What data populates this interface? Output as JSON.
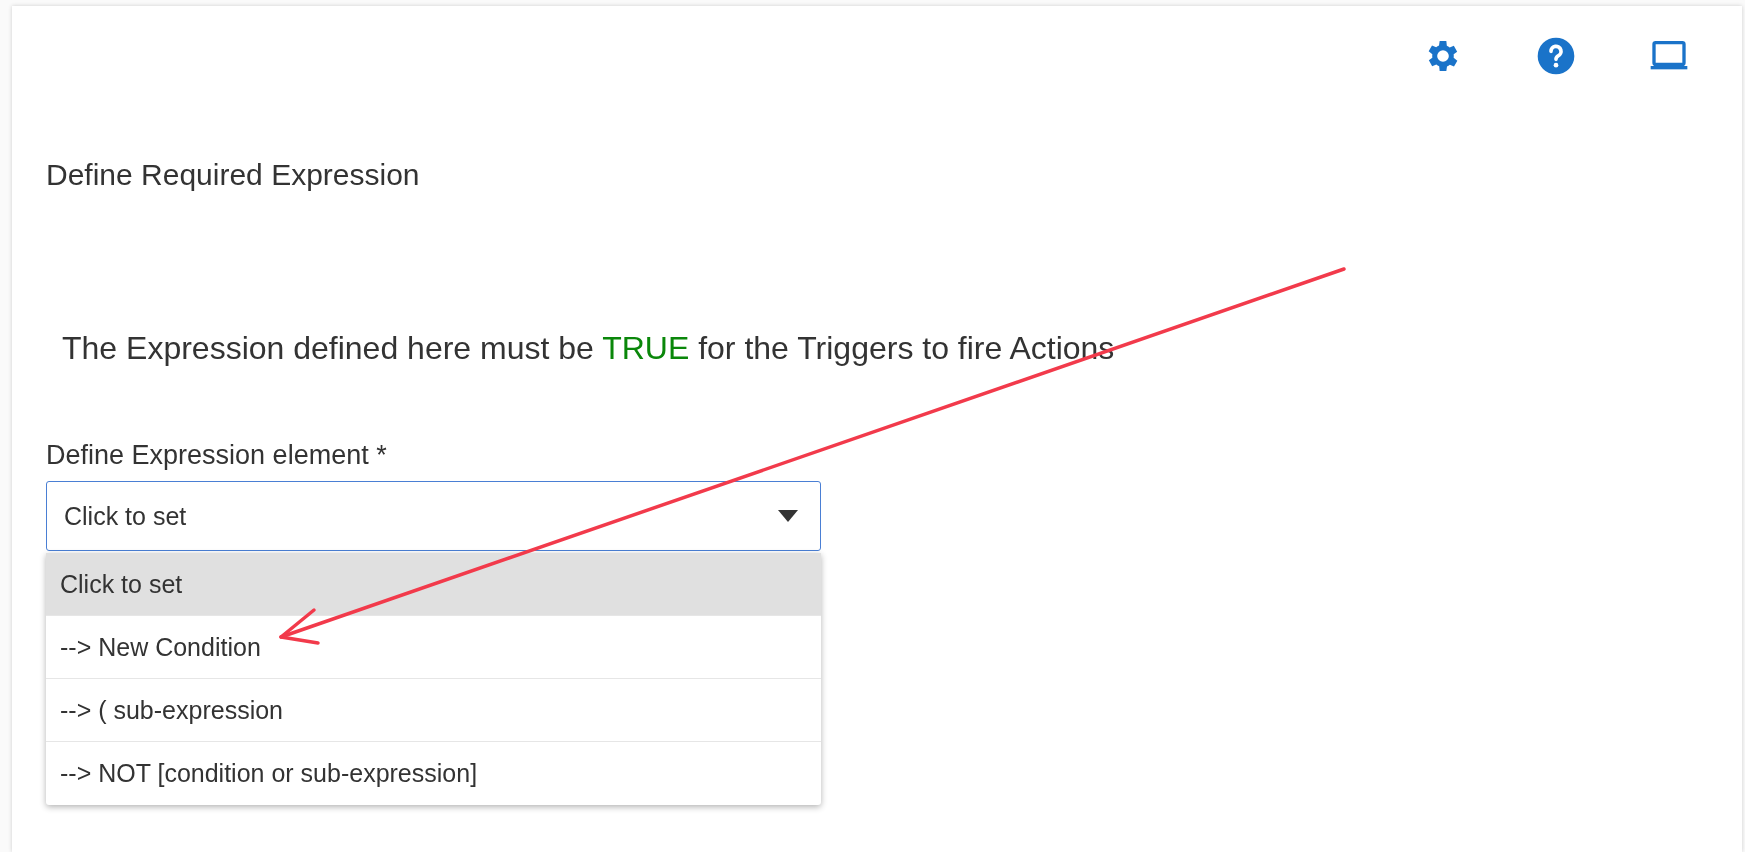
{
  "toolbar": {
    "icons": [
      {
        "kind": "settings"
      },
      {
        "kind": "help"
      },
      {
        "kind": "laptop"
      }
    ]
  },
  "title": "Define Required Expression",
  "notice": {
    "before": "The Expression defined here must be ",
    "highlight": "TRUE",
    "after": " for the Triggers to fire Actions"
  },
  "expression_field": {
    "label": "Define Expression element *",
    "value": "Click to set",
    "expanded": true,
    "options": [
      {
        "label": "Click to set",
        "selected": true
      },
      {
        "label": "--> New Condition",
        "selected": false
      },
      {
        "label": "--> ( sub-expression",
        "selected": false
      },
      {
        "label": "--> NOT [condition or sub-expression]",
        "selected": false
      }
    ]
  }
}
